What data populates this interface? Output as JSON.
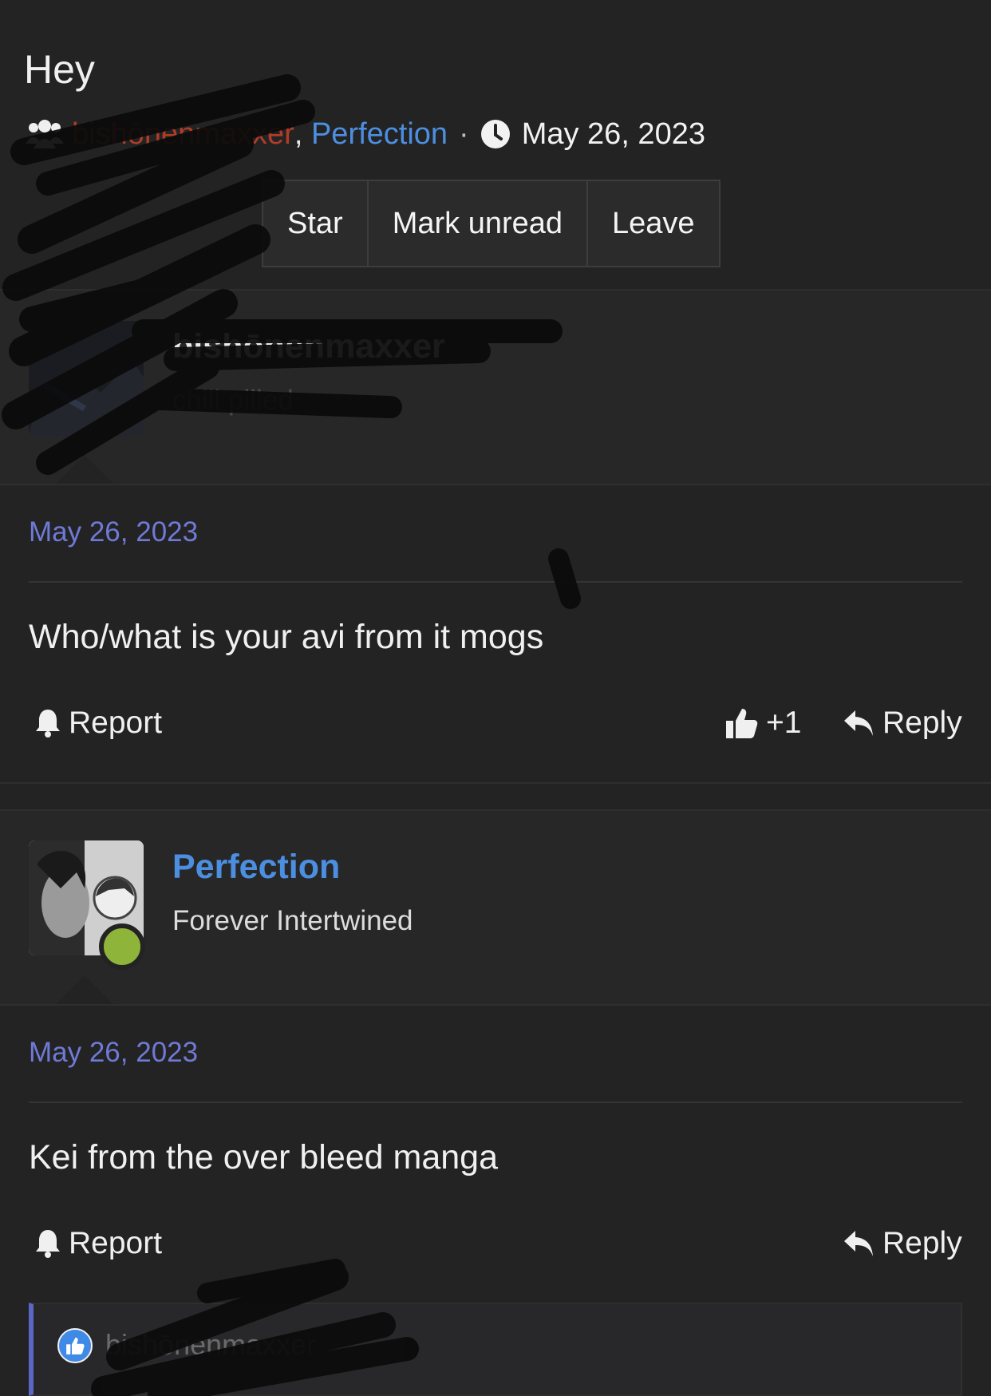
{
  "conversation": {
    "title": "Hey",
    "participants": [
      "bishōnenmaxxer",
      "Perfection"
    ],
    "participant_separator": ",",
    "dot": "·",
    "date": "May 26, 2023",
    "buttons": {
      "star": "Star",
      "mark_unread": "Mark unread",
      "leave": "Leave"
    }
  },
  "messages": [
    {
      "author": "bishōnenmaxxer",
      "author_title": "chill pilled",
      "author_color": "#b13c26",
      "date": "May 26, 2023",
      "text": "Who/what is your avi from it mogs",
      "report_label": "Report",
      "like_count": "+1",
      "reply_label": "Reply"
    },
    {
      "author": "Perfection",
      "author_title": "Forever Intertwined",
      "author_color": "#4c8fe0",
      "online": true,
      "date": "May 26, 2023",
      "text": "Kei from the over bleed manga",
      "report_label": "Report",
      "reply_label": "Reply",
      "reactions": [
        {
          "type": "like",
          "user": "bishōnenmaxxer"
        }
      ]
    }
  ],
  "colors": {
    "background": "#232324",
    "date_link": "#6f7ad6",
    "online": "#8eb53a",
    "accent_border": "#5c66c4"
  },
  "icons": [
    "users-icon",
    "clock-icon",
    "bell-icon",
    "thumbs-up-icon",
    "reply-icon"
  ]
}
